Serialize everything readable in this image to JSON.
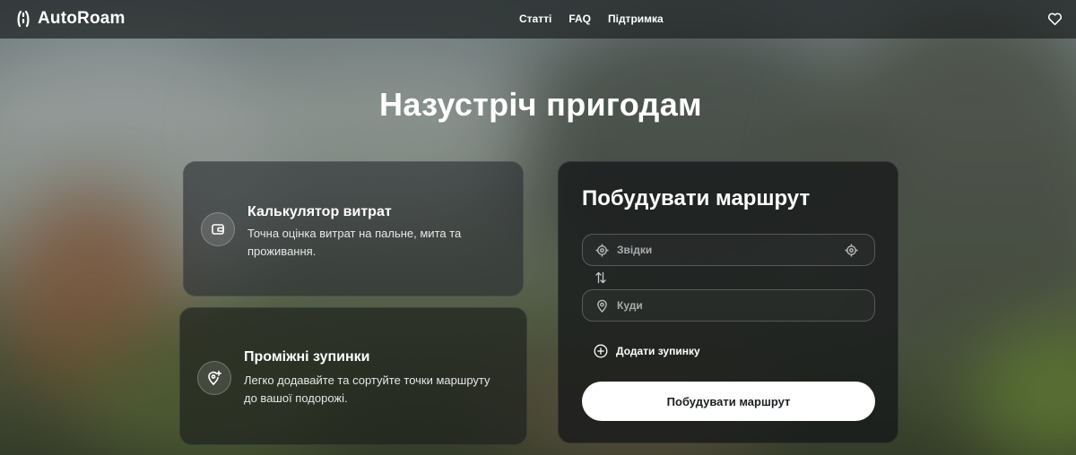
{
  "header": {
    "logo_text": "AutoRoam",
    "logo_icon": "road-icon",
    "nav": [
      {
        "label": "Статті"
      },
      {
        "label": "FAQ"
      },
      {
        "label": "Підтримка"
      }
    ],
    "favorites_icon": "heart-icon"
  },
  "hero": {
    "title": "Назустріч пригодам"
  },
  "features": [
    {
      "icon": "wallet-icon",
      "title": "Калькулятор витрат",
      "description": "Точна оцінка витрат на пальне, мита та проживання."
    },
    {
      "icon": "map-pin-plus-icon",
      "title": "Проміжні зупинки",
      "description": "Легко додавайте та сортуйте точки маршруту до вашої подорожі."
    }
  ],
  "route_form": {
    "title": "Побудувати маршрут",
    "from": {
      "placeholder": "Звідки",
      "value": ""
    },
    "to": {
      "placeholder": "Куди",
      "value": ""
    },
    "add_stop_label": "Додати зупинку",
    "submit_label": "Побудувати маршрут"
  },
  "colors": {
    "button_bg": "#ffffff",
    "button_text": "#1b1d1f",
    "panel_bg": "#16181a"
  }
}
